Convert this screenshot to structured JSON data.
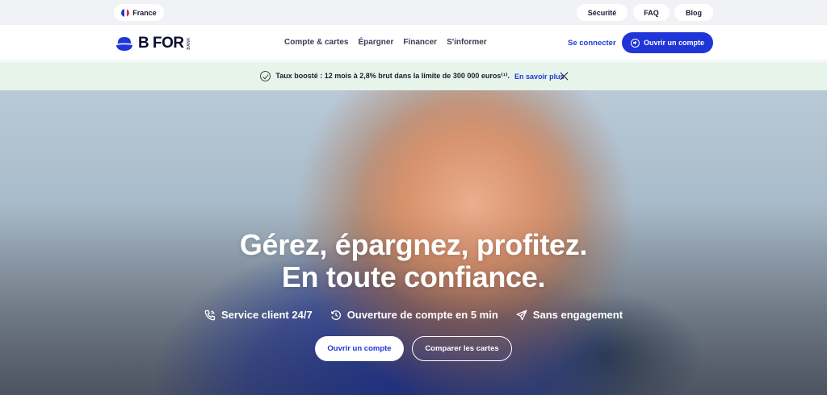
{
  "topbar": {
    "country": "France",
    "links": [
      "Sécurité",
      "FAQ",
      "Blog"
    ]
  },
  "header": {
    "logo_text": "B FOR",
    "logo_sub": "BANK",
    "nav": [
      "Compte & cartes",
      "Épargner",
      "Financer",
      "S'informer"
    ],
    "connect_label": "Se connecter",
    "open_account_label": "Ouvrir un compte"
  },
  "promo": {
    "text": "Taux boosté : 12 mois à 2,8% brut dans la limite de 300 000 euros⁽¹⁾.",
    "link_label": "En savoir plus"
  },
  "hero": {
    "title_line1": "Gérez, épargnez, profitez.",
    "title_line2": "En toute confiance.",
    "features": [
      "Service client 24/7",
      "Ouverture de compte en 5 min",
      "Sans engagement"
    ],
    "primary_button": "Ouvrir un compte",
    "secondary_button": "Comparer les cartes"
  },
  "colors": {
    "brand_blue": "#1f35d8",
    "promo_bg": "#e7f4ea",
    "topbar_bg": "#f1f2f5"
  },
  "icons": {
    "country": "france-flag-icon",
    "promo": "check-circle-icon",
    "promo_close": "close-icon",
    "features": [
      "phone-icon",
      "clock-history-icon",
      "send-icon"
    ]
  }
}
